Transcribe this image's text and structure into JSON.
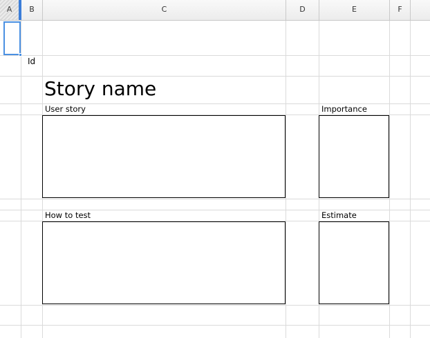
{
  "columns": [
    "A",
    "B",
    "C",
    "D",
    "E",
    "F"
  ],
  "cells": {
    "id_label": "Id",
    "story_name": "Story name",
    "user_story_label": "User story",
    "importance_label": "Importance",
    "how_to_test_label": "How to test",
    "estimate_label": "Estimate"
  },
  "colors": {
    "selection": "#4a90e2",
    "grid": "#dadada",
    "box_border": "#000000"
  }
}
